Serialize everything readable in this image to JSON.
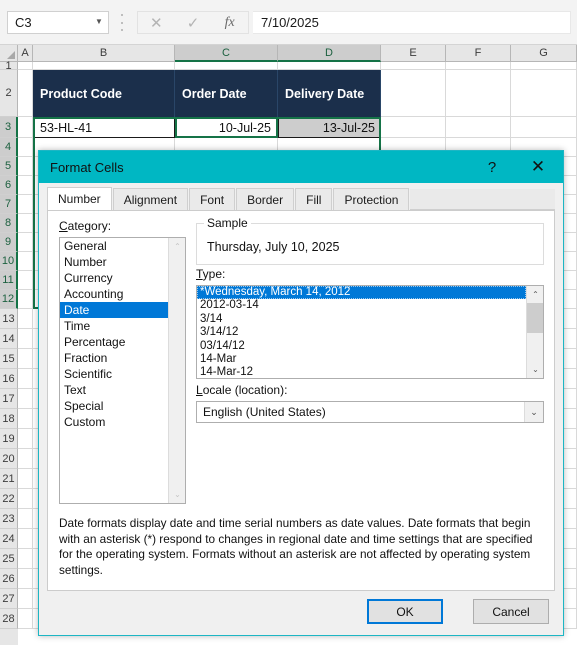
{
  "formula_bar": {
    "name_box_value": "C3",
    "name_box_arrow": "▼",
    "cancel_icon": "✕",
    "enter_icon": "✓",
    "insert_function_icon": "fx",
    "formula_value": "7/10/2025"
  },
  "grid": {
    "columns": [
      {
        "label": "A",
        "selected": false
      },
      {
        "label": "B",
        "selected": false
      },
      {
        "label": "C",
        "selected": true
      },
      {
        "label": "D",
        "selected": true
      },
      {
        "label": "E",
        "selected": false
      },
      {
        "label": "F",
        "selected": false
      },
      {
        "label": "G",
        "selected": false
      }
    ],
    "rows": [
      "1",
      "2",
      "3",
      "4",
      "5",
      "6",
      "7",
      "8",
      "9",
      "10",
      "11",
      "12",
      "13",
      "14",
      "15",
      "16",
      "17",
      "18",
      "19",
      "20",
      "21",
      "22",
      "23",
      "24",
      "25",
      "26",
      "27",
      "28"
    ],
    "selected_rows": [
      "3",
      "4",
      "5",
      "6",
      "7",
      "8",
      "9",
      "10",
      "11",
      "12"
    ],
    "header_row": {
      "product_code": "Product Code",
      "order_date": "Order Date",
      "delivery_date": "Delivery Date"
    },
    "row3": {
      "product_code": "53-HL-41",
      "order_date": "10-Jul-25",
      "delivery_date": "13-Jul-25"
    },
    "header_fill": "#1b2f4b",
    "selection_color": "#157347"
  },
  "dialog": {
    "title": "Format Cells",
    "help_icon": "?",
    "close_icon": "✕",
    "titlebar_color": "#00b7c3",
    "tabs": [
      {
        "label": "Number",
        "active": true
      },
      {
        "label": "Alignment",
        "active": false
      },
      {
        "label": "Font",
        "active": false
      },
      {
        "label": "Border",
        "active": false
      },
      {
        "label": "Fill",
        "active": false
      },
      {
        "label": "Protection",
        "active": false
      }
    ],
    "category": {
      "label": "Category:",
      "items": [
        "General",
        "Number",
        "Currency",
        "Accounting",
        "Date",
        "Time",
        "Percentage",
        "Fraction",
        "Scientific",
        "Text",
        "Special",
        "Custom"
      ],
      "selected": "Date",
      "scroll_up_icon": "⌃",
      "scroll_down_icon": "⌄"
    },
    "sample": {
      "legend": "Sample",
      "value": "Thursday, July 10, 2025"
    },
    "type": {
      "label": "Type:",
      "items": [
        "*Wednesday, March 14, 2012",
        "2012-03-14",
        "3/14",
        "3/14/12",
        "03/14/12",
        "14-Mar",
        "14-Mar-12"
      ],
      "selected": "*Wednesday, March 14, 2012",
      "scroll_up_icon": "⌃",
      "scroll_down_icon": "⌄"
    },
    "locale": {
      "label": "Locale (location):",
      "value": "English (United States)",
      "arrow_icon": "⌄"
    },
    "description": "Date formats display date and time serial numbers as date values.  Date formats that begin with an asterisk (*) respond to changes in regional date and time settings that are specified for the operating system. Formats without an asterisk are not affected by operating system settings.",
    "ok_label": "OK",
    "cancel_label": "Cancel",
    "focus_color": "#0078d7"
  }
}
